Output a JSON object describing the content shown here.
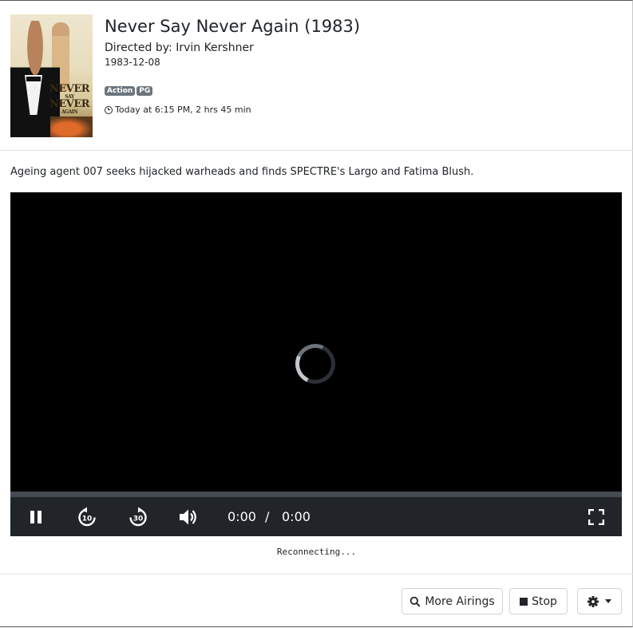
{
  "movie": {
    "title": "Never Say Never Again (1983)",
    "director": "Directed by: Irvin Kershner",
    "date": "1983-12-08",
    "badges": [
      "Action",
      "PG"
    ],
    "airtime": "Today at 6:15 PM, 2 hrs 45 min",
    "description": "Ageing agent 007 seeks hijacked warheads and finds SPECTRE's Largo and Fatima Blush."
  },
  "poster": {
    "line1": "NEVER",
    "line2": "SAY",
    "line3": "NEVER",
    "line4": "AGAIN"
  },
  "player": {
    "current_time": "0:00",
    "separator": "/",
    "duration": "0:00",
    "progress": 0,
    "state": "loading",
    "icons": {
      "pause": "pause-icon",
      "rewind": "rewind-10-icon",
      "forward": "forward-30-icon",
      "volume": "volume-icon",
      "fullscreen": "fullscreen-icon"
    },
    "skip_back_seconds": "10",
    "skip_forward_seconds": "30"
  },
  "status": "Reconnecting...",
  "footer": {
    "more_airings_label": "More Airings",
    "stop_label": "Stop"
  },
  "colors": {
    "badge_bg": "#6c757d",
    "player_bg": "#000000",
    "controls_bg": "#212529"
  }
}
